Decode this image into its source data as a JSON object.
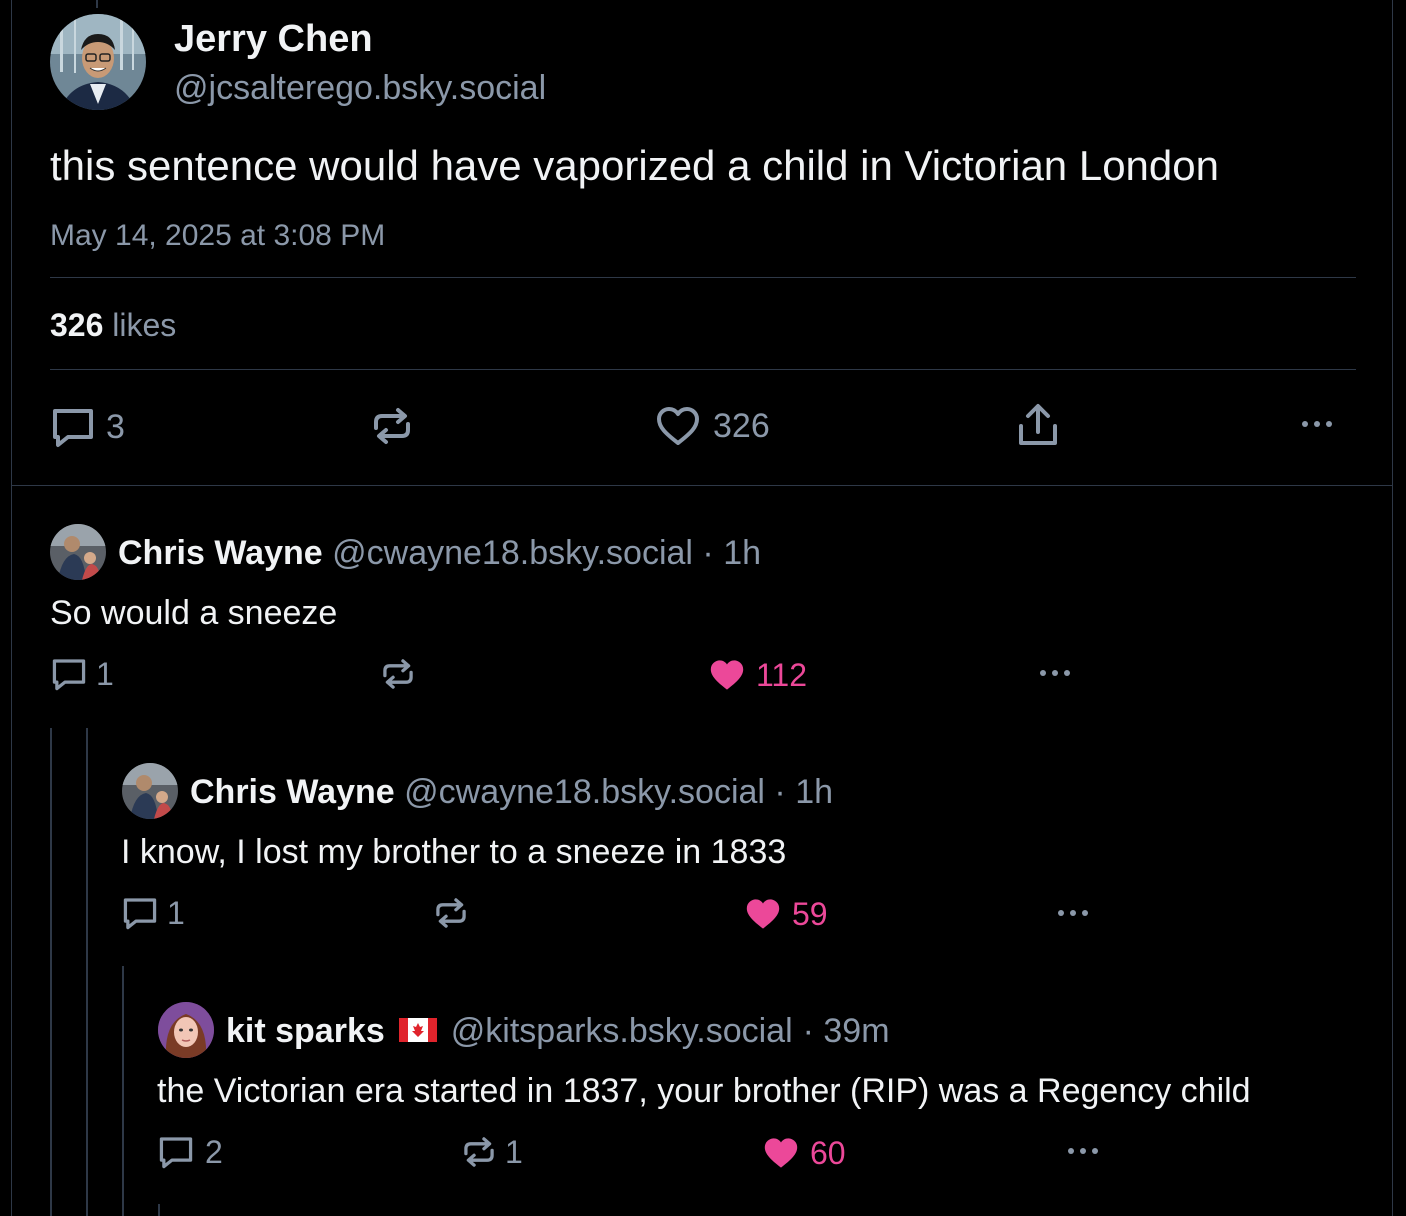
{
  "post": {
    "author_name": "Jerry Chen",
    "author_handle": "@jcsalterego.bsky.social",
    "text": "this sentence would have vaporized a child in Victorian London",
    "timestamp": "May 14, 2025 at 3:08 PM",
    "likes_count": "326",
    "likes_label": "likes",
    "actions": {
      "replies": "3",
      "reposts": "",
      "likes": "326"
    }
  },
  "replies": [
    {
      "author_name": "Chris Wayne",
      "author_handle": "@cwayne18.bsky.social",
      "time": "· 1h",
      "text": "So would a sneeze",
      "replies": "1",
      "reposts": "",
      "likes": "112",
      "liked": true
    },
    {
      "author_name": "Chris Wayne",
      "author_handle": "@cwayne18.bsky.social",
      "time": "· 1h",
      "text": "I know, I lost my brother to a sneeze in 1833",
      "replies": "1",
      "reposts": "",
      "likes": "59",
      "liked": true
    },
    {
      "author_name": "kit sparks",
      "author_flag": "canada-flag",
      "author_handle": "@kitsparks.bsky.social",
      "time": "· 39m",
      "text": "the Victorian era started in 1837, your brother (RIP) was a Regency child",
      "replies": "2",
      "reposts": "1",
      "likes": "60",
      "liked": true
    }
  ],
  "colors": {
    "background": "#000000",
    "text": "#f1f3f5",
    "muted": "#8b98a9",
    "divider": "#2e3847",
    "like_active": "#ec4899"
  },
  "icons": [
    "reply-icon",
    "repost-icon",
    "heart-icon",
    "share-icon",
    "more-icon"
  ]
}
